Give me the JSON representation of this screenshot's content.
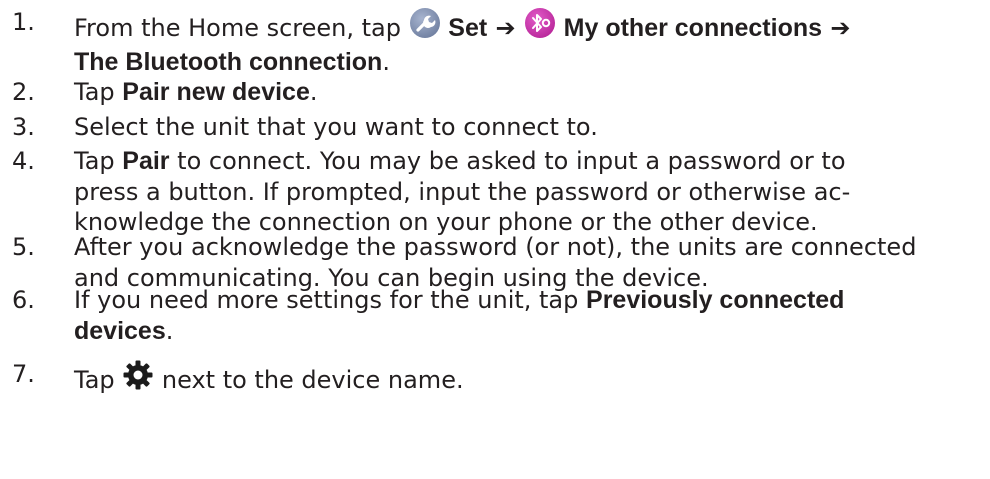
{
  "steps": [
    {
      "number": "1.",
      "segments": [
        {
          "kind": "text",
          "text": "From the Home screen, tap "
        },
        {
          "kind": "icon",
          "icon": "wrench-settings-icon"
        },
        {
          "kind": "text",
          "text": " "
        },
        {
          "kind": "bold",
          "text": "Set"
        },
        {
          "kind": "arrow",
          "text": " ➔ "
        },
        {
          "kind": "icon",
          "icon": "bluetooth-connections-icon"
        },
        {
          "kind": "text",
          "text": " "
        },
        {
          "kind": "bold",
          "text": "My other connections"
        },
        {
          "kind": "arrow",
          "text": " ➔"
        },
        {
          "kind": "break"
        },
        {
          "kind": "bold",
          "text": "The Bluetooth connection"
        },
        {
          "kind": "text",
          "text": "."
        }
      ]
    },
    {
      "number": "2.",
      "segments": [
        {
          "kind": "text",
          "text": "Tap "
        },
        {
          "kind": "bold",
          "text": "Pair new device"
        },
        {
          "kind": "text",
          "text": "."
        }
      ]
    },
    {
      "number": "3.",
      "segments": [
        {
          "kind": "text",
          "text": "Select the unit that you want to connect to."
        }
      ]
    },
    {
      "number": "4.",
      "segments": [
        {
          "kind": "text",
          "text": "Tap "
        },
        {
          "kind": "bold",
          "text": "Pair"
        },
        {
          "kind": "text",
          "text": " to connect. You may be asked to input a password or to"
        },
        {
          "kind": "break"
        },
        {
          "kind": "text",
          "text": "press a button. If prompted, input the password or otherwise ac-"
        },
        {
          "kind": "break"
        },
        {
          "kind": "text",
          "text": "knowledge the connection on your phone or the other device."
        }
      ]
    },
    {
      "number": "5.",
      "segments": [
        {
          "kind": "text",
          "text": "After you acknowledge the password (or not), the units are connected"
        },
        {
          "kind": "break"
        },
        {
          "kind": "text",
          "text": "and communicating. You can begin using the device."
        }
      ]
    },
    {
      "number": "6.",
      "segments": [
        {
          "kind": "text",
          "text": "If you need more settings for the unit, tap "
        },
        {
          "kind": "bold",
          "text": "Previously connected"
        },
        {
          "kind": "break"
        },
        {
          "kind": "bold",
          "text": "devices"
        },
        {
          "kind": "text",
          "text": "."
        }
      ]
    },
    {
      "number": "7.",
      "segments": [
        {
          "kind": "text",
          "text": "Tap "
        },
        {
          "kind": "icon",
          "icon": "gear-icon"
        },
        {
          "kind": "text",
          "text": " next to the device name."
        }
      ]
    }
  ],
  "colors": {
    "text": "#231f20",
    "wrench_icon_bg": "#6f7fa0",
    "bluetooth_icon_bg": "#b8279a"
  }
}
